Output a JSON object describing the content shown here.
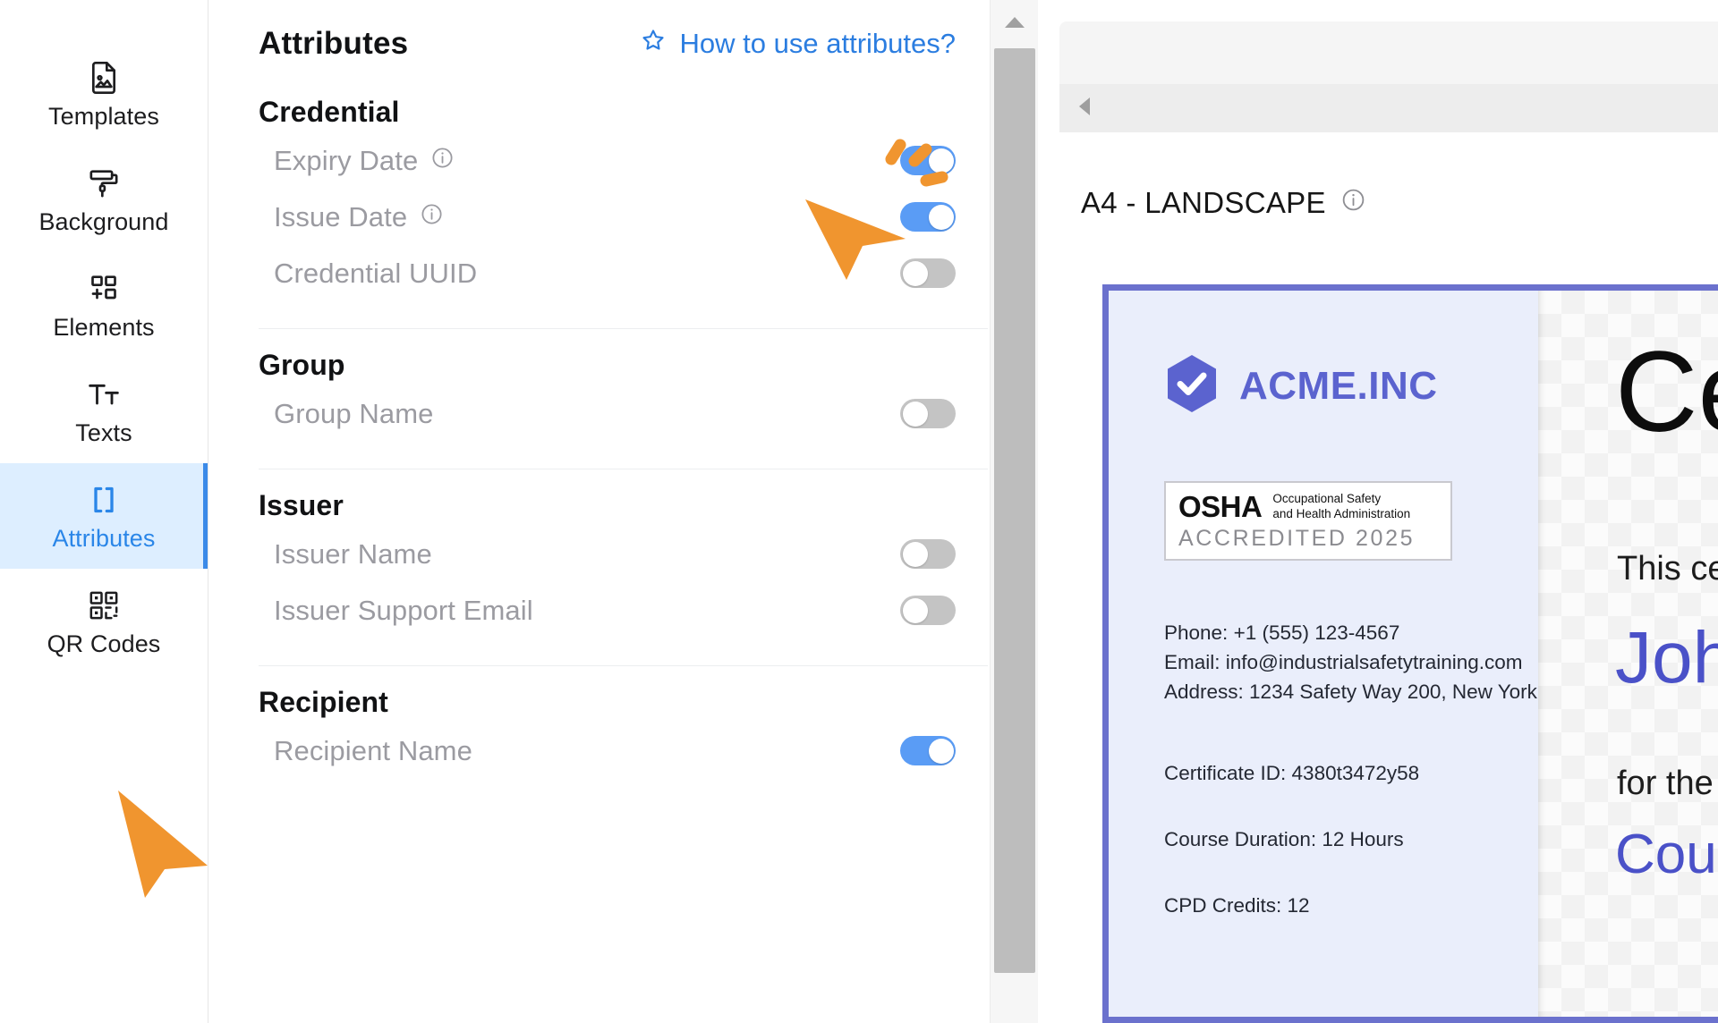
{
  "rail": {
    "items": [
      {
        "label": "Templates",
        "icon": "image-file-icon",
        "active": false
      },
      {
        "label": "Background",
        "icon": "paint-roller-icon",
        "active": false
      },
      {
        "label": "Elements",
        "icon": "add-elements-icon",
        "active": false
      },
      {
        "label": "Texts",
        "icon": "text-size-icon",
        "active": false
      },
      {
        "label": "Attributes",
        "icon": "brackets-icon",
        "active": true
      },
      {
        "label": "QR Codes",
        "icon": "qr-code-icon",
        "active": false
      }
    ]
  },
  "panel": {
    "title": "Attributes",
    "howto_label": "How to use attributes?",
    "howto_icon": "star-icon",
    "groups": [
      {
        "title": "Credential",
        "rows": [
          {
            "label": "Expiry Date",
            "info": true,
            "toggle": "on"
          },
          {
            "label": "Issue Date",
            "info": true,
            "toggle": "on"
          },
          {
            "label": "Credential UUID",
            "info": false,
            "toggle": "off"
          }
        ]
      },
      {
        "title": "Group",
        "rows": [
          {
            "label": "Group Name",
            "info": false,
            "toggle": "off"
          }
        ]
      },
      {
        "title": "Issuer",
        "rows": [
          {
            "label": "Issuer Name",
            "info": false,
            "toggle": "off"
          },
          {
            "label": "Issuer Support Email",
            "info": false,
            "toggle": "off"
          }
        ]
      },
      {
        "title": "Recipient",
        "rows": [
          {
            "label": "Recipient Name",
            "info": false,
            "toggle": "on"
          }
        ]
      }
    ]
  },
  "canvas": {
    "page_label": "A4 - LANDSCAPE",
    "page_info_icon": "info-icon",
    "scroll_up_icon": "triangle-up-icon",
    "scroll_left_icon": "triangle-left-icon"
  },
  "certificate": {
    "border_color": "#6b71cd",
    "sidebar_bg": "#eaeefb",
    "brand": {
      "name": "ACME.INC",
      "logo_icon": "check-hexagon-icon",
      "logo_color": "#5b63cf"
    },
    "accreditation": {
      "word": "OSHA",
      "subtitle_line1": "Occupational Safety",
      "subtitle_line2": "and Health Administration",
      "accredited": "ACCREDITED 2025"
    },
    "contact": {
      "phone": "Phone: +1 (555) 123-4567",
      "email": "Email: info@industrialsafetytraining.com",
      "address": "Address: 1234 Safety Way 200, New York"
    },
    "meta": {
      "certificate_id": "Certificate ID: 4380t3472y58",
      "course_duration": "Course Duration: 12 Hours",
      "cpd_credits": "CPD Credits: 12"
    },
    "body": {
      "title": "Certificate",
      "line1": "This certifies that",
      "recipient_name": "John Doe",
      "line2": "for the completion of",
      "course_name": "Course Name"
    }
  },
  "colors": {
    "accent_blue": "#2a86e8",
    "toggle_on": "#5a9cf5",
    "toggle_off": "#c4c4c4",
    "cursor_orange": "#f0952f",
    "click_dot_blue": "#1a7ef0",
    "sidebar_active_bg": "#ddeeff"
  }
}
